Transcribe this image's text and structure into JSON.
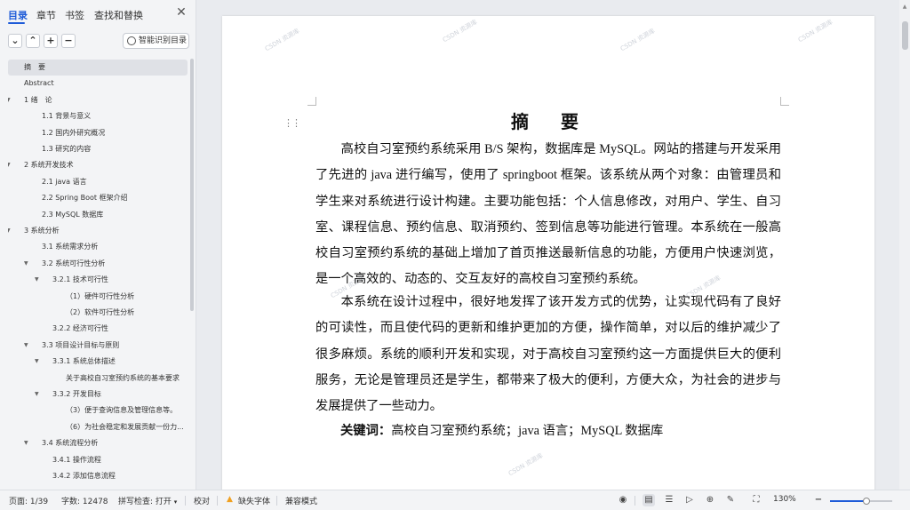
{
  "panel": {
    "tabs": [
      {
        "label": "目录",
        "active": true
      },
      {
        "label": "章节",
        "active": false
      },
      {
        "label": "书签",
        "active": false
      },
      {
        "label": "查找和替换",
        "active": false
      }
    ],
    "close_icon": "close-icon",
    "toolbar": {
      "collapse_icon": "chevron-down-icon",
      "expand_icon": "chevron-up-icon",
      "add_icon": "plus-icon",
      "remove_icon": "minus-icon",
      "smart_toc_label": "智能识别目录"
    }
  },
  "toc": [
    {
      "label": "摘　要",
      "level": 0,
      "caret": false,
      "selected": true
    },
    {
      "label": "Abstract",
      "level": 0,
      "caret": false
    },
    {
      "label": "1 绪　论",
      "level": 0,
      "caret": true
    },
    {
      "label": "1.1 背景与意义",
      "level": 1,
      "caret": false
    },
    {
      "label": "1.2 国内外研究概况",
      "level": 1,
      "caret": false
    },
    {
      "label": "1.3 研究的内容",
      "level": 1,
      "caret": false
    },
    {
      "label": "2 系统开发技术",
      "level": 0,
      "caret": true
    },
    {
      "label": "2.1 java 语言",
      "level": 1,
      "caret": false
    },
    {
      "label": "2.2 Spring Boot 框架介绍",
      "level": 1,
      "caret": false
    },
    {
      "label": "2.3 MySQL 数据库",
      "level": 1,
      "caret": false
    },
    {
      "label": "3 系统分析",
      "level": 0,
      "caret": true
    },
    {
      "label": "3.1 系统需求分析",
      "level": 1,
      "caret": false
    },
    {
      "label": "3.2 系统可行性分析",
      "level": 1,
      "caret": true
    },
    {
      "label": "3.2.1 技术可行性",
      "level": 2,
      "caret": true
    },
    {
      "label": "（1）硬件可行性分析",
      "level": 3,
      "caret": false
    },
    {
      "label": "（2）软件可行性分析",
      "level": 3,
      "caret": false
    },
    {
      "label": "3.2.2 经济可行性",
      "level": 2,
      "caret": false
    },
    {
      "label": "3.3 项目设计目标与原则",
      "level": 1,
      "caret": true
    },
    {
      "label": "3.3.1 系统总体描述",
      "level": 2,
      "caret": true
    },
    {
      "label": "关于高校自习室预约系统的基本要求",
      "level": 3,
      "caret": false
    },
    {
      "label": "3.3.2 开发目标",
      "level": 2,
      "caret": true
    },
    {
      "label": "（3）便于查询信息及管理信息等。",
      "level": 3,
      "caret": false
    },
    {
      "label": "（6）为社会稳定和发展贡献一份力...",
      "level": 3,
      "caret": false
    },
    {
      "label": "3.4 系统流程分析",
      "level": 1,
      "caret": true
    },
    {
      "label": "3.4.1 操作流程",
      "level": 2,
      "caret": false
    },
    {
      "label": "3.4.2 添加信息流程",
      "level": 2,
      "caret": false
    }
  ],
  "document": {
    "title": "摘　要",
    "paragraphs": [
      "高校自习室预约系统采用 B/S 架构，数据库是 MySQL。网站的搭建与开发采用了先进的 java 进行编写，使用了 springboot 框架。该系统从两个对象：由管理员和学生来对系统进行设计构建。主要功能包括：个人信息修改，对用户、学生、自习室、课程信息、预约信息、取消预约、签到信息等功能进行管理。本系统在一般高校自习室预约系统的基础上增加了首页推送最新信息的功能，方便用户快速浏览，是一个高效的、动态的、交互友好的高校自习室预约系统。",
      "本系统在设计过程中，很好地发挥了该开发方式的优势，让实现代码有了良好的可读性，而且使代码的更新和维护更加的方便，操作简单，对以后的维护减少了很多麻烦。系统的顺利开发和实现，对于高校自习室预约这一方面提供巨大的便利服务，无论是管理员还是学生，都带来了极大的便利，方便大众，为社会的进步与发展提供了一些动力。"
    ],
    "keywords_label": "关键词：",
    "keywords": "高校自习室预约系统；java 语言；MySQL 数据库"
  },
  "status_bar": {
    "page": "页面: 1/39",
    "word_count": "字数: 12478",
    "spell_check": "拼写检查: 打开",
    "spell_check_caret": "▾",
    "proofread": "校对",
    "missing_font": "缺失字体",
    "compat_mode": "兼容模式",
    "zoom": "130%",
    "zoom_level_fraction": 0.58,
    "icons": [
      "eye-icon",
      "page-view-icon",
      "outline-view-icon",
      "play-icon",
      "web-view-icon",
      "pen-icon",
      "fit-page-icon"
    ]
  },
  "colors": {
    "accent": "#1e5bd8",
    "panel_bg": "#f3f4f6",
    "workspace_bg": "#e9ebef",
    "warning": "#f0a020"
  }
}
